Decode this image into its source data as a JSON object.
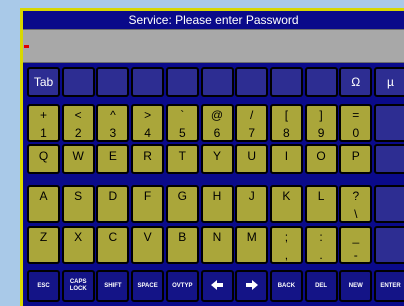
{
  "title": "Service: Please enter Password",
  "password_value": "",
  "row0": [
    {
      "label": "Tab",
      "color": "blue"
    },
    {
      "label": "",
      "color": "blue"
    },
    {
      "label": "",
      "color": "blue"
    },
    {
      "label": "",
      "color": "blue"
    },
    {
      "label": "",
      "color": "blue"
    },
    {
      "label": "",
      "color": "blue"
    },
    {
      "label": "",
      "color": "blue"
    },
    {
      "label": "",
      "color": "blue"
    },
    {
      "label": "",
      "color": "blue"
    },
    {
      "label": "Ω",
      "color": "blue"
    },
    {
      "label": "µ",
      "color": "blue"
    }
  ],
  "row1": [
    {
      "top": "+",
      "bottom": "1"
    },
    {
      "top": "<",
      "bottom": "2"
    },
    {
      "top": "^",
      "bottom": "3"
    },
    {
      "top": ">",
      "bottom": "4"
    },
    {
      "top": "`",
      "bottom": "5"
    },
    {
      "top": "@",
      "bottom": "6"
    },
    {
      "top": "/",
      "bottom": "7"
    },
    {
      "top": "[",
      "bottom": "8"
    },
    {
      "top": "]",
      "bottom": "9"
    },
    {
      "top": "=",
      "bottom": "0"
    },
    {
      "top": "",
      "bottom": ""
    }
  ],
  "row2": [
    "Q",
    "W",
    "E",
    "R",
    "T",
    "Y",
    "U",
    "I",
    "O",
    "P",
    ""
  ],
  "row3": [
    {
      "top": "A",
      "bottom": ""
    },
    {
      "top": "S",
      "bottom": ""
    },
    {
      "top": "D",
      "bottom": ""
    },
    {
      "top": "F",
      "bottom": ""
    },
    {
      "top": "G",
      "bottom": ""
    },
    {
      "top": "H",
      "bottom": ""
    },
    {
      "top": "J",
      "bottom": ""
    },
    {
      "top": "K",
      "bottom": ""
    },
    {
      "top": "L",
      "bottom": ""
    },
    {
      "top": "?",
      "bottom": "\\"
    },
    {
      "top": "",
      "bottom": ""
    }
  ],
  "row4": [
    {
      "top": "Z",
      "bottom": ""
    },
    {
      "top": "X",
      "bottom": ""
    },
    {
      "top": "C",
      "bottom": ""
    },
    {
      "top": "V",
      "bottom": ""
    },
    {
      "top": "B",
      "bottom": ""
    },
    {
      "top": "N",
      "bottom": ""
    },
    {
      "top": "M",
      "bottom": ""
    },
    {
      "top": ";",
      "bottom": ","
    },
    {
      "top": ":",
      "bottom": "."
    },
    {
      "top": "_",
      "bottom": "-"
    },
    {
      "top": "",
      "bottom": ""
    }
  ],
  "controls": [
    {
      "label": "ESC",
      "icon": ""
    },
    {
      "label": "CAPS LOCK",
      "icon": ""
    },
    {
      "label": "SHIFT",
      "icon": ""
    },
    {
      "label": "SPACE",
      "icon": ""
    },
    {
      "label": "OVTYP",
      "icon": ""
    },
    {
      "label": "",
      "icon": "arrow-left-icon"
    },
    {
      "label": "",
      "icon": "arrow-right-icon"
    },
    {
      "label": "BACK",
      "icon": ""
    },
    {
      "label": "DEL",
      "icon": ""
    },
    {
      "label": "NEW",
      "icon": ""
    },
    {
      "label": "ENTER",
      "icon": ""
    }
  ],
  "colors": {
    "frame_blue": "#0a0a8a",
    "key_yellow": "#aaa63a",
    "key_blue": "#2d2d92",
    "border_yellow": "#d8d800",
    "entry_gray": "#a8a8a8",
    "cursor_red": "#e00000"
  }
}
